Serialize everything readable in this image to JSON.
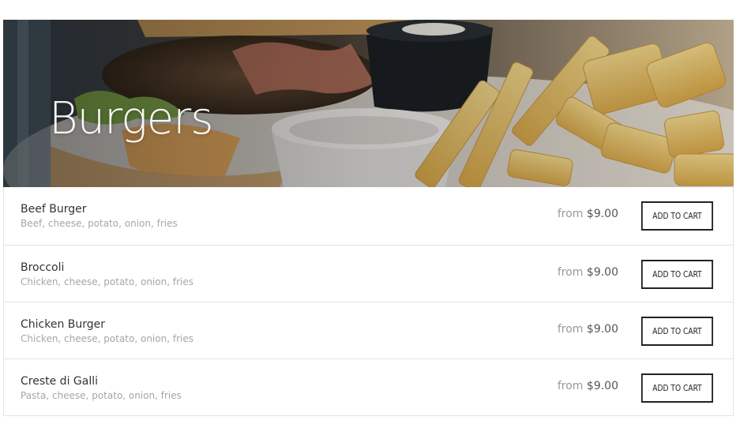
{
  "section": {
    "title": "Burgers",
    "collapse_icon": "chevron-up-icon"
  },
  "items": [
    {
      "name": "Beef Burger",
      "description": "Beef, cheese, potato, onion, fries",
      "price_prefix": "from",
      "price": "$9.00",
      "button_label": "Add to cart"
    },
    {
      "name": "Broccoli",
      "description": "Chicken, cheese, potato, onion, fries",
      "price_prefix": "from",
      "price": "$9.00",
      "button_label": "Add to cart"
    },
    {
      "name": "Chicken Burger",
      "description": "Chicken, cheese, potato, onion, fries",
      "price_prefix": "from",
      "price": "$9.00",
      "button_label": "Add to cart"
    },
    {
      "name": "Creste di Galli",
      "description": "Pasta, cheese, potato, onion, fries",
      "price_prefix": "from",
      "price": "$9.00",
      "button_label": "Add to cart"
    }
  ],
  "colors": {
    "text_primary": "#333333",
    "text_muted": "#a6a6a6",
    "border": "#e3e3e3",
    "button_border": "#222222"
  }
}
